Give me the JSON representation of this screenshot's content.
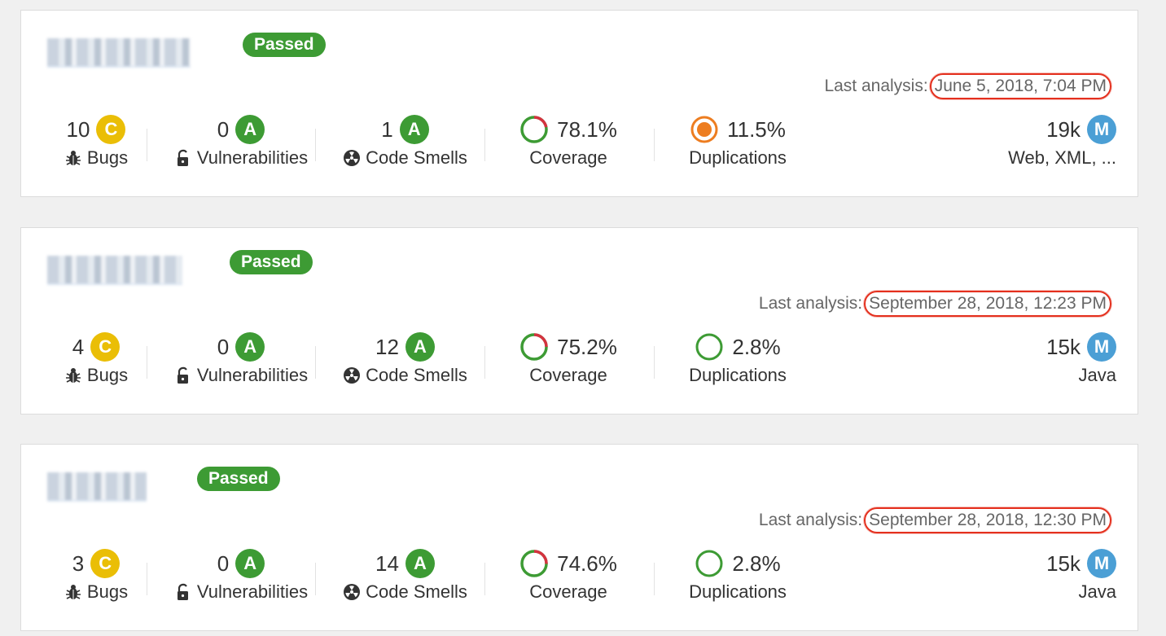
{
  "projects": [
    {
      "status": "Passed",
      "analysis_label": "Last analysis:",
      "analysis_date": "June 5, 2018, 7:04 PM",
      "bugs": {
        "value": "10",
        "rating": "C",
        "label": "Bugs"
      },
      "vulnerabilities": {
        "value": "0",
        "rating": "A",
        "label": "Vulnerabilities"
      },
      "code_smells": {
        "value": "1",
        "rating": "A",
        "label": "Code Smells"
      },
      "coverage": {
        "value": "78.1%",
        "label": "Coverage",
        "percent": 78.1
      },
      "duplications": {
        "value": "11.5%",
        "label": "Duplications"
      },
      "size": {
        "value": "19k",
        "rating": "M",
        "label": "Web, XML, ..."
      }
    },
    {
      "status": "Passed",
      "analysis_label": "Last analysis:",
      "analysis_date": "September 28, 2018, 12:23 PM",
      "bugs": {
        "value": "4",
        "rating": "C",
        "label": "Bugs"
      },
      "vulnerabilities": {
        "value": "0",
        "rating": "A",
        "label": "Vulnerabilities"
      },
      "code_smells": {
        "value": "12",
        "rating": "A",
        "label": "Code Smells"
      },
      "coverage": {
        "value": "75.2%",
        "label": "Coverage",
        "percent": 75.2
      },
      "duplications": {
        "value": "2.8%",
        "label": "Duplications"
      },
      "size": {
        "value": "15k",
        "rating": "M",
        "label": "Java"
      }
    },
    {
      "status": "Passed",
      "analysis_label": "Last analysis:",
      "analysis_date": "September 28, 2018, 12:30 PM",
      "bugs": {
        "value": "3",
        "rating": "C",
        "label": "Bugs"
      },
      "vulnerabilities": {
        "value": "0",
        "rating": "A",
        "label": "Vulnerabilities"
      },
      "code_smells": {
        "value": "14",
        "rating": "A",
        "label": "Code Smells"
      },
      "coverage": {
        "value": "74.6%",
        "label": "Coverage",
        "percent": 74.6
      },
      "duplications": {
        "value": "2.8%",
        "label": "Duplications"
      },
      "size": {
        "value": "15k",
        "rating": "M",
        "label": "Java"
      }
    }
  ],
  "colors": {
    "passed": "#3d9b34",
    "rating_c": "#eabe06",
    "rating_a": "#3d9b34",
    "rating_m": "#4b9fd5",
    "coverage_covered": "#3d9b34",
    "coverage_uncovered": "#d4333f",
    "duplication_high": "#ed7d20",
    "duplication_low": "#3d9b34",
    "highlight": "#e4301e"
  }
}
